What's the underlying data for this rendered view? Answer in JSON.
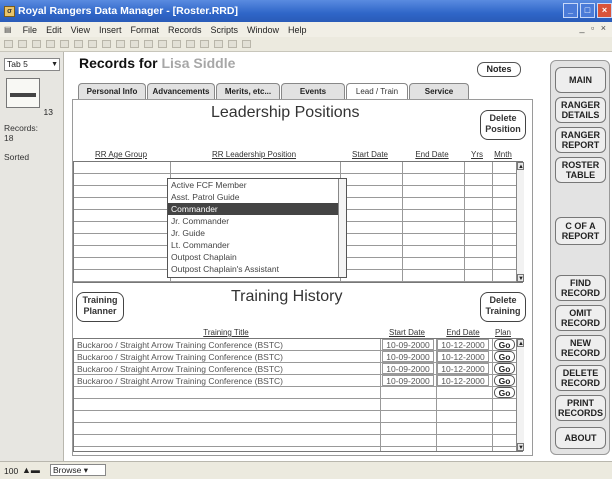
{
  "window": {
    "title": "Royal Rangers Data Manager - [Roster.RRD]",
    "buttons": [
      "_",
      "□",
      "×"
    ]
  },
  "menu": [
    "File",
    "Edit",
    "View",
    "Insert",
    "Format",
    "Records",
    "Scripts",
    "Window",
    "Help"
  ],
  "left_panel": {
    "layout": "Tab 5",
    "page_number": "13",
    "records_label": "Records:",
    "records_value": "18",
    "sort_status": "Sorted"
  },
  "header": {
    "title_prefix": "Records for",
    "person_name": "Lisa Siddle",
    "notes_label": "Notes"
  },
  "tabs": [
    {
      "label": "Personal Info",
      "active": false
    },
    {
      "label": "Advancements",
      "active": false
    },
    {
      "label": "Merits, etc...",
      "active": false
    },
    {
      "label": "Events",
      "active": false
    },
    {
      "label": "Lead / Train",
      "active": true
    },
    {
      "label": "Service",
      "active": false
    }
  ],
  "leadership": {
    "title": "Leadership Positions",
    "delete_label_1": "Delete",
    "delete_label_2": "Position",
    "columns": [
      "RR Age Group",
      "RR Leadership Position",
      "Start Date",
      "End Date",
      "Yrs",
      "Mnth"
    ],
    "dropdown_options": [
      {
        "label": "Active FCF Member",
        "selected": false
      },
      {
        "label": "Asst. Patrol Guide",
        "selected": false
      },
      {
        "label": "Commander",
        "selected": true
      },
      {
        "label": "Jr. Commander",
        "selected": false
      },
      {
        "label": "Jr. Guide",
        "selected": false
      },
      {
        "label": "Lt. Commander",
        "selected": false
      },
      {
        "label": "Outpost Chaplain",
        "selected": false
      },
      {
        "label": "Outpost Chaplain's Assistant",
        "selected": false
      }
    ]
  },
  "training": {
    "title": "Training History",
    "planner_label_1": "Training",
    "planner_label_2": "Planner",
    "delete_label_1": "Delete",
    "delete_label_2": "Training",
    "columns": [
      "Training Title",
      "Start Date",
      "End Date",
      "Plan"
    ],
    "rows": [
      {
        "title": "Buckaroo / Straight Arrow Training Conference (BSTC)",
        "start": "10-09-2000",
        "end": "10-12-2000",
        "go": "Go"
      },
      {
        "title": "Buckaroo / Straight Arrow Training Conference (BSTC)",
        "start": "10-09-2000",
        "end": "10-12-2000",
        "go": "Go"
      },
      {
        "title": "Buckaroo / Straight Arrow Training Conference (BSTC)",
        "start": "10-09-2000",
        "end": "10-12-2000",
        "go": "Go"
      },
      {
        "title": "Buckaroo / Straight Arrow Training Conference (BSTC)",
        "start": "10-09-2000",
        "end": "10-12-2000",
        "go": "Go"
      }
    ],
    "empty_go": "Go"
  },
  "right_nav": [
    {
      "line1": "MAIN",
      "line2": ""
    },
    {
      "line1": "RANGER",
      "line2": "DETAILS"
    },
    {
      "line1": "RANGER",
      "line2": "REPORT"
    },
    {
      "line1": "ROSTER",
      "line2": "TABLE"
    },
    {
      "line1": "C OF A",
      "line2": "REPORT"
    },
    {
      "line1": "FIND",
      "line2": "RECORD"
    },
    {
      "line1": "OMIT",
      "line2": "RECORD"
    },
    {
      "line1": "NEW",
      "line2": "RECORD"
    },
    {
      "line1": "DELETE",
      "line2": "RECORD"
    },
    {
      "line1": "PRINT",
      "line2": "RECORDS"
    },
    {
      "line1": "ABOUT",
      "line2": ""
    }
  ],
  "status": {
    "zoom": "100",
    "mode": "Browse"
  }
}
